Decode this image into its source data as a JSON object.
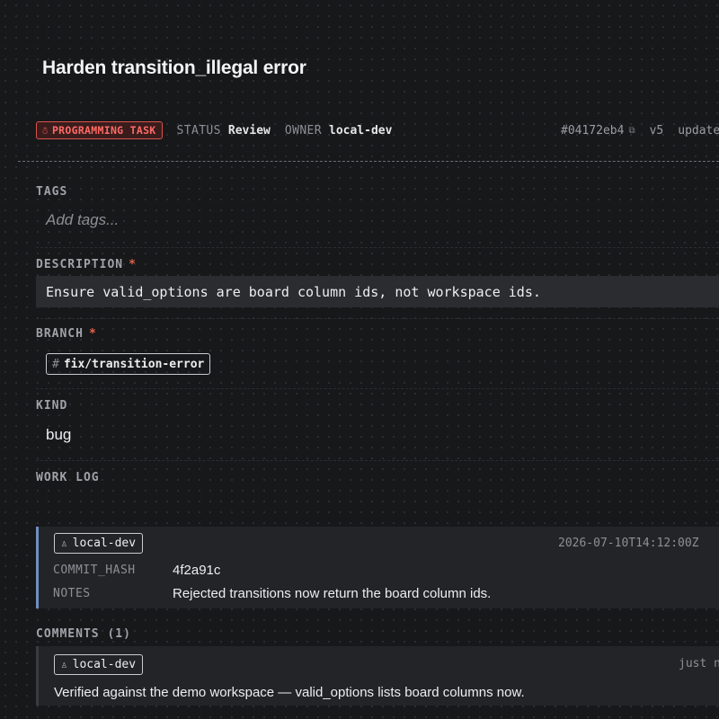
{
  "task": {
    "title": "Harden transition_illegal error",
    "type_badge": "PROGRAMMING TASK",
    "status_label": "STATUS",
    "status_value": "Review",
    "owner_label": "OWNER",
    "owner_value": "local-dev",
    "id": "#04172eb4",
    "version": "v5",
    "updated": "updated ju"
  },
  "tags": {
    "label": "TAGS",
    "placeholder": "Add tags..."
  },
  "description": {
    "label": "DESCRIPTION",
    "required": "*",
    "value": "Ensure valid_options are board column ids, not workspace ids."
  },
  "branch": {
    "label": "BRANCH",
    "required": "*",
    "hash": "#",
    "value": "fix/transition-error"
  },
  "kind": {
    "label": "KIND",
    "value": "bug"
  },
  "work_log": {
    "label": "WORK LOG",
    "entries": [
      {
        "user": "local-dev",
        "timestamp": "2026-07-10T14:12:00Z",
        "fields": [
          {
            "key": "COMMIT_HASH",
            "value": "4f2a91c"
          },
          {
            "key": "NOTES",
            "value": "Rejected transitions now return the board column ids."
          }
        ]
      }
    ]
  },
  "comments": {
    "label": "COMMENTS (1)",
    "items": [
      {
        "user": "local-dev",
        "time": "just n",
        "text": "Verified against the demo workspace — valid_options lists board columns now."
      }
    ]
  },
  "icons": {
    "badge": "bug-icon",
    "copy": "copy-icon",
    "user": "user-icon",
    "hash": "hash-icon"
  },
  "colors": {
    "accent_red": "#ff6b66",
    "worklog_accent": "#6f8fbf",
    "background": "#17181a"
  }
}
